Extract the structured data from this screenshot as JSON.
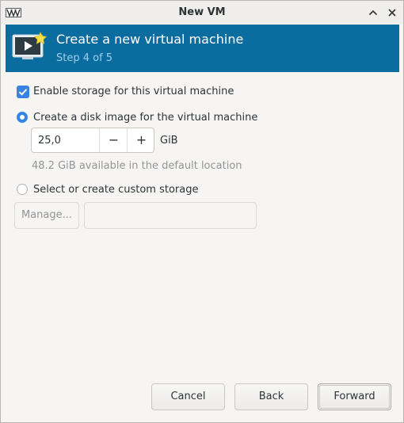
{
  "window": {
    "title": "New VM",
    "app_icon": "virt-manager-icon",
    "controls": {
      "minimize_icon": "chevron-up-icon",
      "close_icon": "close-icon"
    }
  },
  "banner": {
    "icon": "new-vm-icon",
    "title": "Create a new virtual machine",
    "subtitle": "Step 4 of 5",
    "background_color": "#0b6d9f",
    "subtitle_color": "#9ad0ee"
  },
  "storage": {
    "enable_label": "Enable storage for this virtual machine",
    "enable_checked": true,
    "disk_image_label": "Create a disk image for the virtual machine",
    "disk_image_selected": true,
    "size_value": "25,0",
    "decrement_symbol": "−",
    "increment_symbol": "+",
    "size_unit": "GiB",
    "available_hint": "48.2 GiB available in the default location",
    "custom_label": "Select or create custom storage",
    "custom_selected": false,
    "manage_label": "Manage...",
    "custom_path_value": ""
  },
  "footer": {
    "cancel_label": "Cancel",
    "back_label": "Back",
    "forward_label": "Forward"
  },
  "colors": {
    "accent": "#3584e4",
    "window_bg": "#f6f5f4",
    "disabled_text": "#929595"
  }
}
